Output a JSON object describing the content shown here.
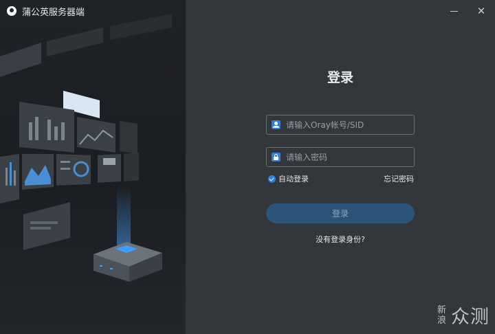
{
  "app": {
    "title": "蒲公英服务器端"
  },
  "window": {
    "minimize_icon": "minimize-icon",
    "close_glyph": "✕"
  },
  "login": {
    "title": "登录",
    "account_placeholder": "请输入Oray帐号/SID",
    "password_placeholder": "请输入密码",
    "auto_login_label": "自动登录",
    "auto_login_checked": true,
    "forgot_password": "忘记密码",
    "login_button": "登录",
    "no_identity_link": "没有登录身份?"
  },
  "watermark": {
    "small": "新浪",
    "big": "众测"
  },
  "colors": {
    "accent": "#2f7fe0",
    "button": "#2c5378",
    "panel": "#33363a",
    "illustration_bg": "#1f2226"
  }
}
